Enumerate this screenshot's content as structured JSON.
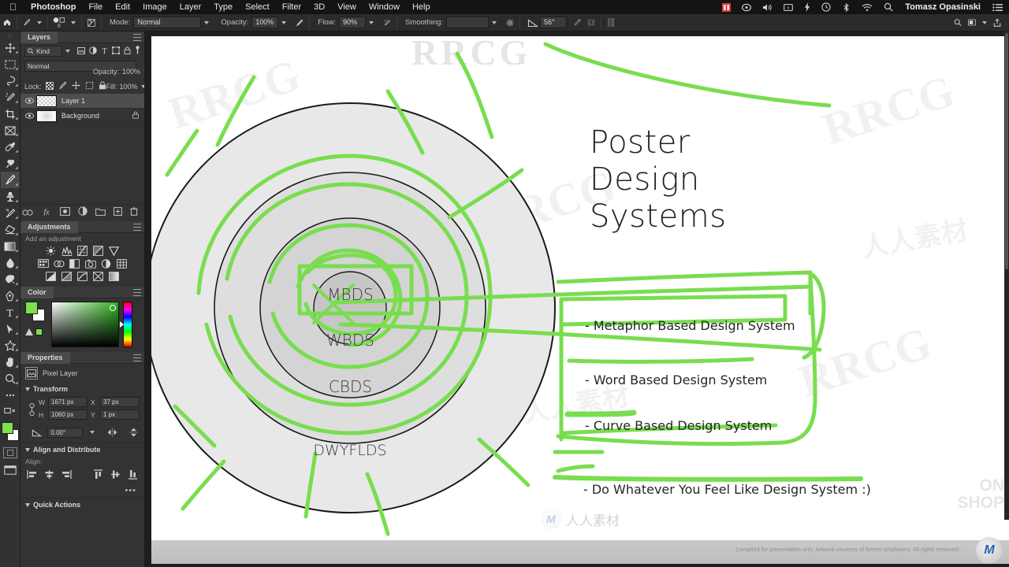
{
  "menubar": {
    "apple_icon": "apple-icon",
    "items": [
      {
        "label": "Photoshop",
        "bold": true
      },
      {
        "label": "File",
        "bold": false
      },
      {
        "label": "Edit",
        "bold": false
      },
      {
        "label": "Image",
        "bold": false
      },
      {
        "label": "Layer",
        "bold": false
      },
      {
        "label": "Type",
        "bold": false
      },
      {
        "label": "Select",
        "bold": false
      },
      {
        "label": "Filter",
        "bold": false
      },
      {
        "label": "3D",
        "bold": false
      },
      {
        "label": "View",
        "bold": false
      },
      {
        "label": "Window",
        "bold": false
      },
      {
        "label": "Help",
        "bold": false
      }
    ],
    "status_icons": [
      "creative-cloud-icon",
      "dropbox-icon",
      "volume-icon",
      "screen-icon",
      "battery-bolt-icon",
      "time-machine-icon",
      "bluetooth-icon",
      "wifi-icon",
      "search-icon"
    ],
    "user": "Tomasz Opasinski",
    "control_center_icon": "control-center-icon"
  },
  "options_bar": {
    "home_icon": "home-icon",
    "tool_icon": "brush-tool-icon",
    "brush_size": "8",
    "toggle_panel_icon": "brush-panel-icon",
    "mode_label": "Mode:",
    "mode_value": "Normal",
    "opacity_label": "Opacity:",
    "opacity_value": "100%",
    "opacity_pressure_icon": "pressure-opacity-icon",
    "flow_label": "Flow:",
    "flow_value": "90%",
    "airbrush_icon": "airbrush-icon",
    "smoothing_label": "Smoothing:",
    "smoothing_value": "",
    "smoothing_gear_icon": "gear-icon",
    "angle_icon": "angle-icon",
    "angle_value": "56°",
    "pressure_size_icon": "pressure-size-icon",
    "symmetry_icon": "symmetry-icon",
    "pattern_icon": "pattern-icon",
    "right_icons": [
      "search-icon",
      "workspace-icon",
      "chevron-down-icon",
      "share-icon"
    ]
  },
  "toolbar": {
    "grip_icon": "drag-grip-icon",
    "tools": [
      {
        "name": "move-tool",
        "active": false
      },
      {
        "name": "rectangular-marquee-tool",
        "active": false
      },
      {
        "name": "lasso-tool",
        "active": false
      },
      {
        "name": "quick-selection-tool",
        "active": false
      },
      {
        "name": "crop-tool",
        "active": false
      },
      {
        "name": "frame-tool",
        "active": false
      },
      {
        "name": "eyedropper-tool",
        "active": false
      },
      {
        "name": "spot-healing-brush-tool",
        "active": false
      },
      {
        "name": "brush-tool",
        "active": true
      },
      {
        "name": "clone-stamp-tool",
        "active": false
      },
      {
        "name": "history-brush-tool",
        "active": false
      },
      {
        "name": "eraser-tool",
        "active": false
      },
      {
        "name": "gradient-tool",
        "active": false
      },
      {
        "name": "blur-tool",
        "active": false
      },
      {
        "name": "dodge-tool",
        "active": false
      },
      {
        "name": "pen-tool",
        "active": false
      },
      {
        "name": "type-tool",
        "active": false
      },
      {
        "name": "path-selection-tool",
        "active": false
      },
      {
        "name": "shape-tool",
        "active": false
      },
      {
        "name": "hand-tool",
        "active": false
      },
      {
        "name": "zoom-tool",
        "active": false
      },
      {
        "name": "edit-toolbar-button",
        "active": false
      }
    ],
    "foreground_color": "#7ee04a",
    "background_color": "#ffffff",
    "quick_mask_icon": "quick-mask-icon",
    "screen_mode_icon": "screen-mode-icon"
  },
  "layers_panel": {
    "title": "Layers",
    "filter_placeholder": "Kind",
    "filter_value": "Kind",
    "filter_icons": [
      "pixel-filter-icon",
      "adjustment-filter-icon",
      "type-filter-icon",
      "shape-filter-icon",
      "smart-object-filter-icon",
      "filter-toggle-icon"
    ],
    "blend_mode": "Normal",
    "opacity_label": "Opacity:",
    "opacity_value": "100%",
    "lock_label": "Lock:",
    "lock_icons": [
      "transparency-lock-icon",
      "image-lock-icon",
      "position-lock-icon",
      "artboard-lock-icon",
      "all-lock-icon"
    ],
    "fill_label": "Fill:",
    "fill_value": "100%",
    "layers": [
      {
        "name": "Layer 1",
        "visible": true,
        "selected": true,
        "locked": false,
        "thumb": "transparent-thumb"
      },
      {
        "name": "Background",
        "visible": true,
        "selected": false,
        "locked": true,
        "thumb": "background-thumb"
      }
    ],
    "bottom_icons": [
      "link-layers-icon",
      "layer-style-icon",
      "layer-mask-icon",
      "adjustment-layer-icon",
      "new-group-icon",
      "new-layer-icon",
      "delete-layer-icon"
    ]
  },
  "adjustments_panel": {
    "title": "Adjustments",
    "hint": "Add an adjustment",
    "row1": [
      "brightness-contrast-icon",
      "levels-icon",
      "curves-icon",
      "exposure-icon",
      "vibrance-icon"
    ],
    "row2": [
      "hue-saturation-icon",
      "color-balance-icon",
      "black-white-icon",
      "photo-filter-icon",
      "channel-mixer-icon",
      "color-lookup-icon"
    ],
    "row3": [
      "invert-icon",
      "posterize-icon",
      "threshold-icon",
      "gradient-map-icon",
      "selective-color-icon"
    ]
  },
  "color_panel": {
    "title": "Color",
    "foreground_color": "#7ee04a",
    "background_color": "#ffffff",
    "out_of_gamut_icon": "gamut-warning-icon",
    "field_icon": "color-field",
    "hue_icon": "hue-slider"
  },
  "properties_panel": {
    "title": "Properties",
    "layer_type_icon": "pixel-layer-icon",
    "layer_type": "Pixel Layer",
    "transform": {
      "section": "Transform",
      "link_icon": "link-aspect-icon",
      "w_label": "W",
      "w_value": "1671 px",
      "x_label": "X",
      "x_value": "37 px",
      "h_label": "H",
      "h_value": "1060 px",
      "y_label": "Y",
      "y_value": "1 px",
      "angle_icon": "angle-icon",
      "angle_value": "0.00°",
      "flip_h_icon": "flip-horizontal-icon",
      "flip_v_icon": "flip-vertical-icon"
    },
    "align": {
      "section": "Align and Distribute",
      "label": "Align:",
      "icons": [
        "align-left-icon",
        "align-center-horizontal-icon",
        "align-right-icon",
        "align-top-icon",
        "align-middle-vertical-icon",
        "align-bottom-icon"
      ],
      "more_icon": "more-options-icon"
    },
    "quick_actions": {
      "section": "Quick Actions"
    }
  },
  "canvas": {
    "title_lines": [
      "Poster",
      "Design",
      "Systems"
    ],
    "rings": [
      {
        "label": "MBDS"
      },
      {
        "label": "WBDS"
      },
      {
        "label": "CBDS"
      },
      {
        "label": "DWYFLDS"
      }
    ],
    "legend": [
      "- Metaphor Based Design System",
      "- Word Based Design System",
      "- Curve Based Design System",
      "- Do Whatever You Feel Like Design System :)"
    ],
    "footer_note": "Compiled for presentation only. Artwork courtesy of former employers. All rights reserved.",
    "annotation_color": "#79dd4f",
    "watermark_text": "RRCG",
    "watermark_cn": "人人素材",
    "corner_mark_line1": "ON",
    "corner_mark_line2": "SHOP"
  }
}
